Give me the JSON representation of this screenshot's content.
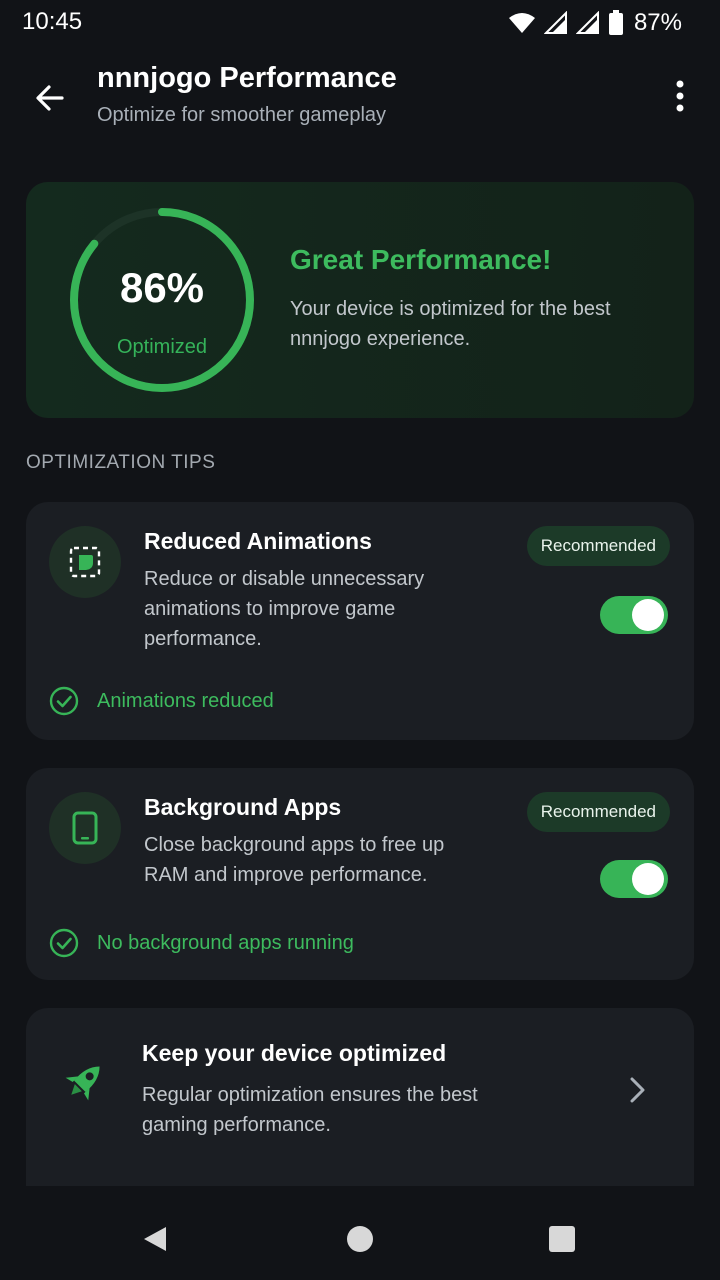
{
  "status_bar": {
    "time": "10:45",
    "battery": "87%"
  },
  "app_bar": {
    "title": "nnnjogo Performance",
    "subtitle": "Optimize for smoother gameplay"
  },
  "score": {
    "percent_text": "86%",
    "percent_value": 86,
    "label": "Optimized",
    "title": "Great Performance!",
    "description": "Your device is optimized for the best nnnjogo experience."
  },
  "section_label": "OPTIMIZATION TIPS",
  "tips": [
    {
      "title": "Reduced Animations",
      "description": "Reduce or disable unnecessary animations to improve game performance.",
      "badge": "Recommended",
      "enabled": true,
      "status": "Animations reduced"
    },
    {
      "title": "Background Apps",
      "description": "Close background apps to free up RAM and improve performance.",
      "badge": "Recommended",
      "enabled": true,
      "status": "No background apps running"
    }
  ],
  "promo": {
    "title": "Keep your device optimized",
    "description": "Regular optimization ensures the best gaming performance."
  },
  "colors": {
    "accent": "#37b457",
    "background": "#111317",
    "card": "#1b1e23"
  }
}
